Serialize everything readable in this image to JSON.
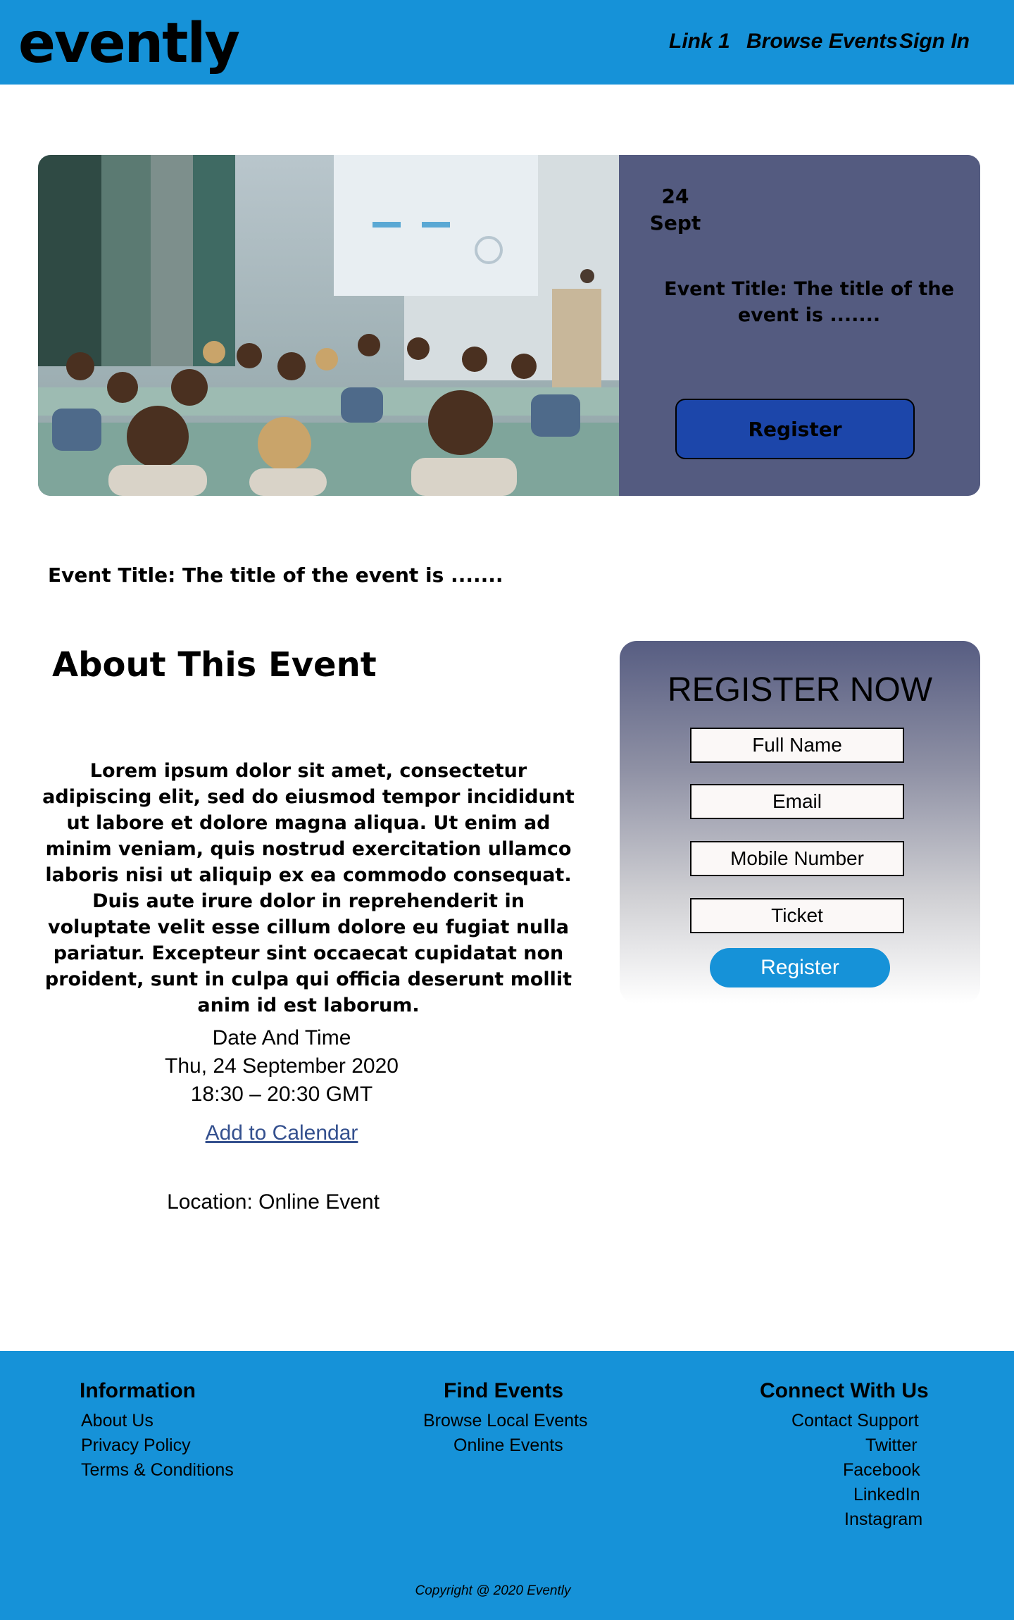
{
  "header": {
    "logo": "evently",
    "nav": [
      "Link 1",
      "Browse Events",
      "Sign In"
    ]
  },
  "hero": {
    "date_day": "24",
    "date_month": "Sept",
    "title": "Event Title: The title of the event is .......",
    "register_label": "Register"
  },
  "event_title_line": "Event Title: The title of the event is .......",
  "about": {
    "heading": "About This Event",
    "body": "Lorem ipsum dolor sit amet, consectetur adipiscing elit, sed do eiusmod tempor incididunt ut labore et dolore magna aliqua. Ut enim ad minim veniam, quis nostrud exercitation ullamco laboris nisi ut aliquip ex ea commodo consequat. Duis aute irure dolor in reprehenderit in voluptate velit esse cillum dolore eu fugiat nulla pariatur. Excepteur sint occaecat cupidatat non proident, sunt in culpa qui officia deserunt mollit anim id est laborum."
  },
  "datetime": {
    "label": "Date And Time",
    "date": "Thu, 24 September 2020",
    "time": "18:30 – 20:30 GMT",
    "calendar_link": "Add to Calendar"
  },
  "location": "Location: Online Event",
  "register_form": {
    "title": "REGISTER NOW",
    "fields": [
      "Full Name",
      "Email",
      "Mobile Number",
      "Ticket"
    ],
    "submit_label": "Register"
  },
  "footer": {
    "information": {
      "heading": "Information",
      "links": [
        "About Us",
        "Privacy Policy",
        "Terms & Conditions"
      ]
    },
    "find_events": {
      "heading": "Find Events",
      "links": [
        "Browse Local Events",
        "Online Events"
      ]
    },
    "connect": {
      "heading": "Connect With Us",
      "links": [
        "Contact Support",
        "Twitter",
        "Facebook",
        "LinkedIn",
        "Instagram"
      ]
    },
    "copyright": "Copyright @ 2020 Evently"
  },
  "colors": {
    "brand_blue": "#1692d8",
    "hero_panel": "#545b80",
    "hero_button": "#1c46aa",
    "link": "#34508e"
  }
}
